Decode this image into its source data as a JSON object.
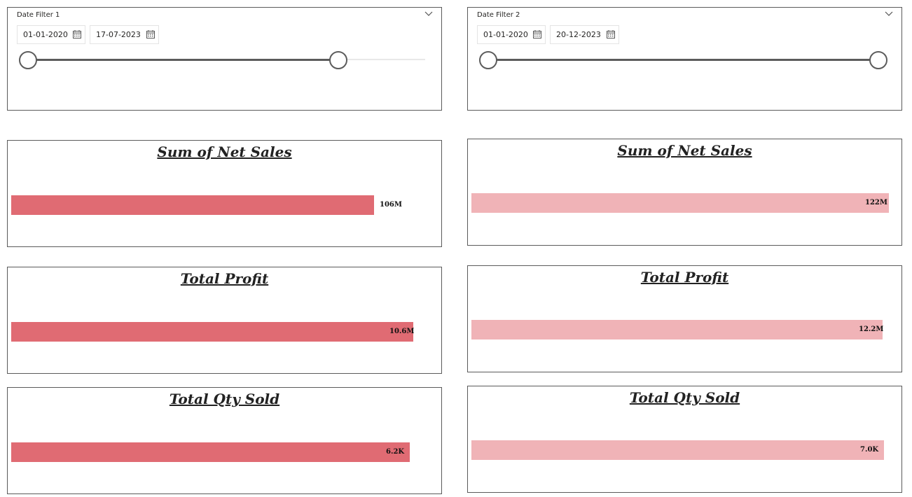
{
  "slicers": [
    {
      "title": "Date Filter 1",
      "start_date": "01-01-2020",
      "end_date": "17-07-2023",
      "range_fraction": [
        0.0,
        0.88
      ]
    },
    {
      "title": "Date Filter 2",
      "start_date": "01-01-2020",
      "end_date": "20-12-2023",
      "range_fraction": [
        0.0,
        1.0
      ]
    }
  ],
  "colors": {
    "filter1_bar": "#e06b73",
    "filter2_bar": "#f0b3b7",
    "border": "#5a5a5a"
  },
  "chart_data": [
    {
      "type": "bar",
      "orientation": "horizontal",
      "title": "Sum of Net Sales",
      "values": [
        106
      ],
      "value_unit": "M",
      "data_label": "106M",
      "xlim": [
        0,
        124
      ],
      "color": "#e06b73"
    },
    {
      "type": "bar",
      "orientation": "horizontal",
      "title": "Sum of Net Sales",
      "values": [
        122
      ],
      "value_unit": "M",
      "data_label": "122M",
      "xlim": [
        0,
        124
      ],
      "color": "#f0b3b7"
    },
    {
      "type": "bar",
      "orientation": "horizontal",
      "title": "Total Profit",
      "values": [
        10.6
      ],
      "value_unit": "M",
      "data_label": "10.6M",
      "xlim": [
        0,
        11.2
      ],
      "color": "#e06b73"
    },
    {
      "type": "bar",
      "orientation": "horizontal",
      "title": "Total Profit",
      "values": [
        12.2
      ],
      "value_unit": "M",
      "data_label": "12.2M",
      "xlim": [
        0,
        12.6
      ],
      "color": "#f0b3b7"
    },
    {
      "type": "bar",
      "orientation": "horizontal",
      "title": "Total Qty Sold",
      "values": [
        6.2
      ],
      "value_unit": "K",
      "data_label": "6.2K",
      "xlim": [
        0,
        6.6
      ],
      "color": "#e06b73"
    },
    {
      "type": "bar",
      "orientation": "horizontal",
      "title": "Total Qty Sold",
      "values": [
        7.0
      ],
      "value_unit": "K",
      "data_label": "7.0K",
      "xlim": [
        0,
        7.2
      ],
      "color": "#f0b3b7"
    }
  ]
}
